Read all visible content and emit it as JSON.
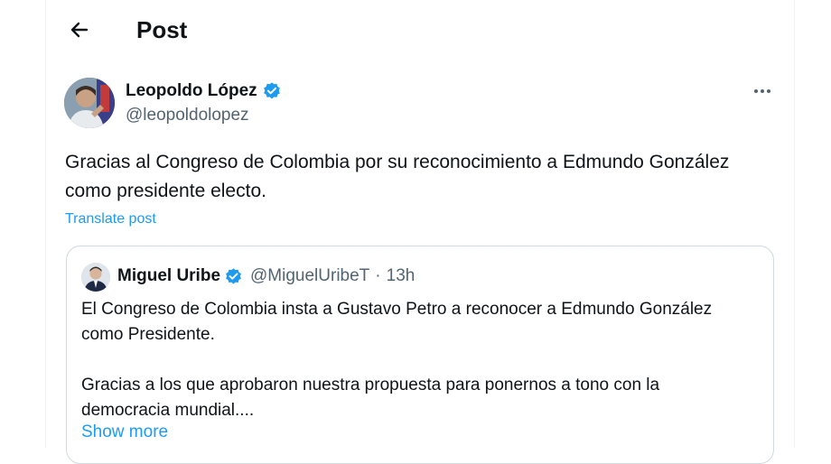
{
  "header": {
    "title": "Post",
    "back_icon": "arrow-left-icon"
  },
  "post": {
    "author_name": "Leopoldo López",
    "author_handle": "@leopoldolopez",
    "verified_color": "#1d9bf0",
    "text": "Gracias al Congreso de Colombia por su reconocimiento a Edmundo González como presidente electo.",
    "translate_label": "Translate post"
  },
  "quote": {
    "author_name": "Miguel Uribe",
    "author_handle": "@MiguelUribeT",
    "time": "13h",
    "separator": "·",
    "paragraph1": "El Congreso de Colombia insta a Gustavo Petro a reconocer a Edmundo González como Presidente.",
    "paragraph2": "Gracias a los que aprobaron nuestra propuesta para ponernos a tono con la democracia mundial....",
    "show_more_label": "Show more"
  },
  "colors": {
    "accent": "#1d9bf0",
    "secondary_text": "#536471",
    "border": "#cfd9de"
  }
}
